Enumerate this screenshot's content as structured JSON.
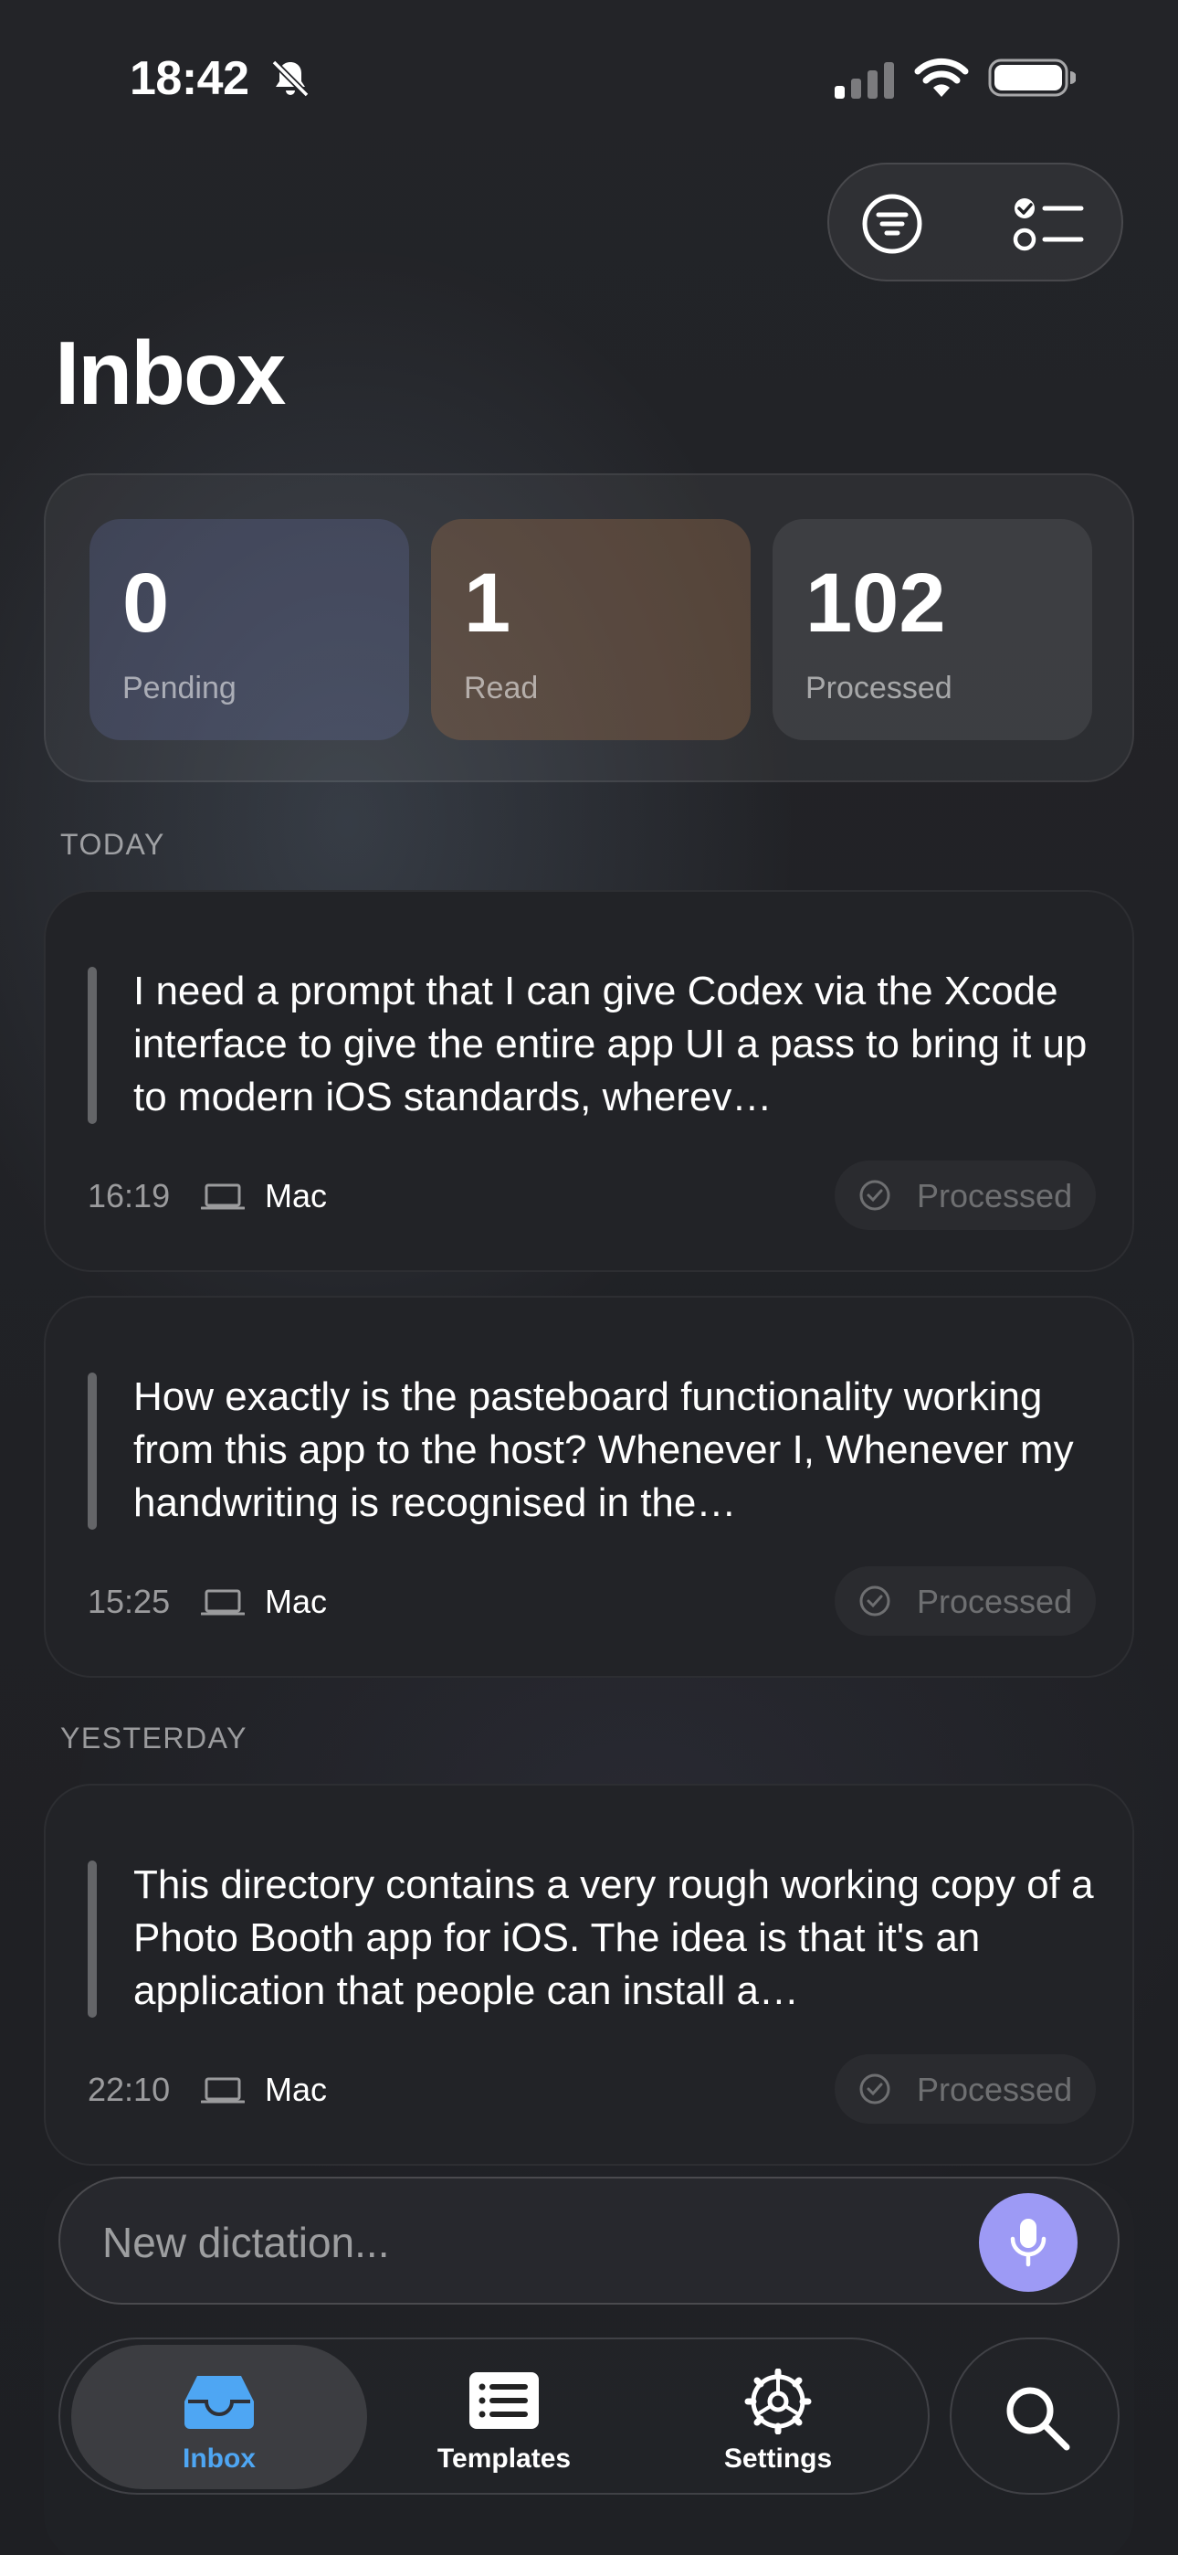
{
  "status_bar": {
    "time": "18:42"
  },
  "page": {
    "title": "Inbox"
  },
  "stats": {
    "pending": {
      "value": "0",
      "label": "Pending"
    },
    "read": {
      "value": "1",
      "label": "Read"
    },
    "processed": {
      "value": "102",
      "label": "Processed"
    }
  },
  "sections": {
    "today": "TODAY",
    "yesterday": "YESTERDAY"
  },
  "items": [
    {
      "text": "I need a prompt that I can give Codex via the Xcode interface to give the entire app UI a pass to bring it up to modern iOS standards, wherev…",
      "time": "16:19",
      "device": "Mac",
      "status": "Processed"
    },
    {
      "text": "How exactly is the pasteboard functionality working from this app to the host? Whenever I, Whenever my handwriting is recognised in the…",
      "time": "15:25",
      "device": "Mac",
      "status": "Processed"
    },
    {
      "text": "This directory contains a very rough working copy of a Photo Booth app for iOS. The idea is that it's an application that people can install a…",
      "time": "22:10",
      "device": "Mac",
      "status": "Processed"
    }
  ],
  "dictation": {
    "placeholder": "New dictation..."
  },
  "tabs": {
    "inbox": "Inbox",
    "templates": "Templates",
    "settings": "Settings"
  },
  "colors": {
    "accent_blue": "#4ea6f3",
    "mic_purple": "#9d9af5",
    "background": "#1f2024"
  }
}
